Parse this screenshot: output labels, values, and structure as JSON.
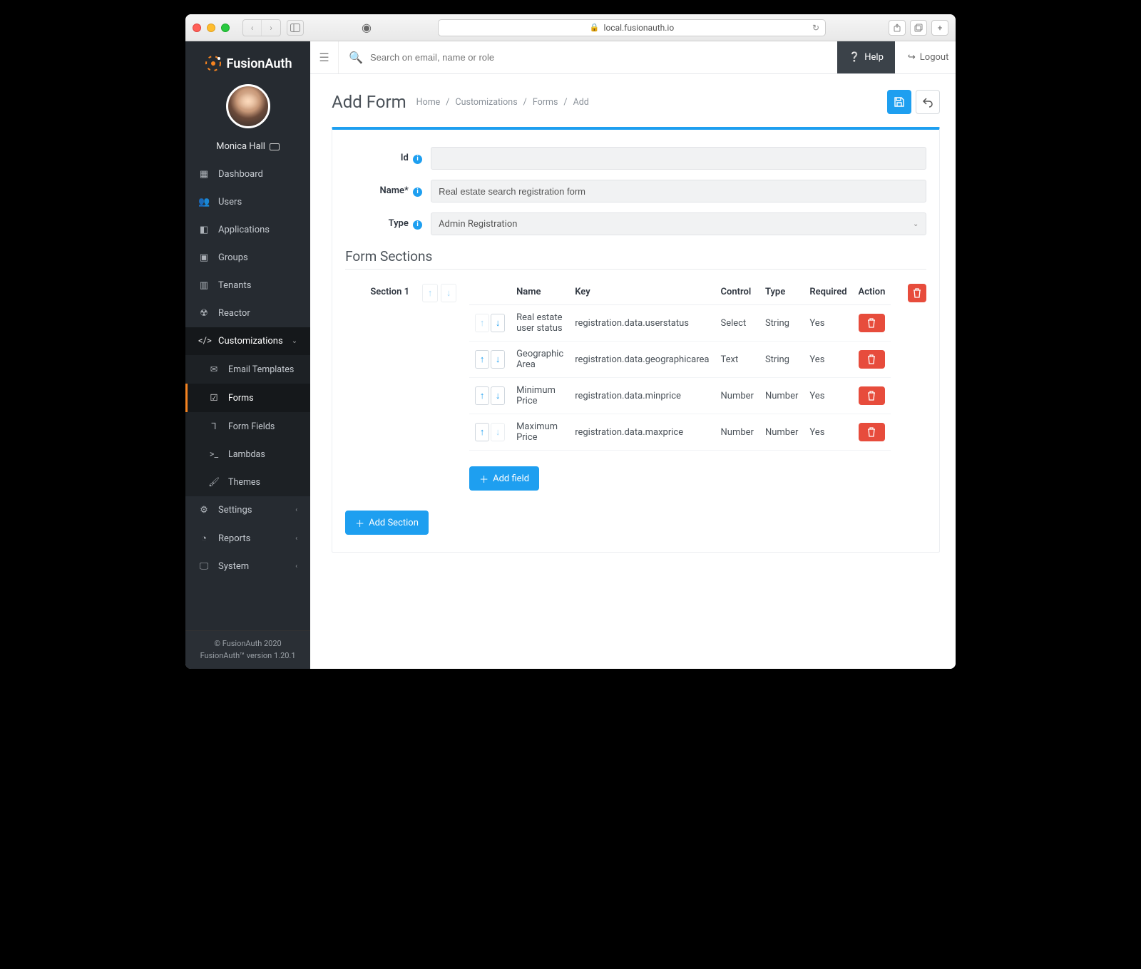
{
  "browser": {
    "url": "local.fusionauth.io"
  },
  "brand": "FusionAuth",
  "user": {
    "name": "Monica Hall"
  },
  "topbar": {
    "search_placeholder": "Search on email, name or role",
    "help": "Help",
    "logout": "Logout"
  },
  "sidebar": {
    "items": [
      {
        "label": "Dashboard"
      },
      {
        "label": "Users"
      },
      {
        "label": "Applications"
      },
      {
        "label": "Groups"
      },
      {
        "label": "Tenants"
      },
      {
        "label": "Reactor"
      }
    ],
    "customizations": {
      "label": "Customizations",
      "children": [
        {
          "label": "Email Templates"
        },
        {
          "label": "Forms"
        },
        {
          "label": "Form Fields"
        },
        {
          "label": "Lambdas"
        },
        {
          "label": "Themes"
        }
      ]
    },
    "bottom": [
      {
        "label": "Settings"
      },
      {
        "label": "Reports"
      },
      {
        "label": "System"
      }
    ],
    "footer1": "© FusionAuth 2020",
    "footer2": "FusionAuth™ version 1.20.1"
  },
  "page": {
    "title": "Add Form",
    "breadcrumb": [
      "Home",
      "Customizations",
      "Forms",
      "Add"
    ]
  },
  "form": {
    "id_label": "Id",
    "id_value": "",
    "name_label": "Name*",
    "name_value": "Real estate search registration form",
    "type_label": "Type",
    "type_value": "Admin Registration",
    "sections_title": "Form Sections",
    "section1_label": "Section 1",
    "table_headers": {
      "name": "Name",
      "key": "Key",
      "control": "Control",
      "type": "Type",
      "required": "Required",
      "action": "Action"
    },
    "fields": [
      {
        "name": "Real estate user status",
        "key": "registration.data.userstatus",
        "control": "Select",
        "type": "String",
        "required": "Yes"
      },
      {
        "name": "Geographic Area",
        "key": "registration.data.geographicarea",
        "control": "Text",
        "type": "String",
        "required": "Yes"
      },
      {
        "name": "Minimum Price",
        "key": "registration.data.minprice",
        "control": "Number",
        "type": "Number",
        "required": "Yes"
      },
      {
        "name": "Maximum Price",
        "key": "registration.data.maxprice",
        "control": "Number",
        "type": "Number",
        "required": "Yes"
      }
    ],
    "add_field": "Add field",
    "add_section": "Add Section"
  }
}
